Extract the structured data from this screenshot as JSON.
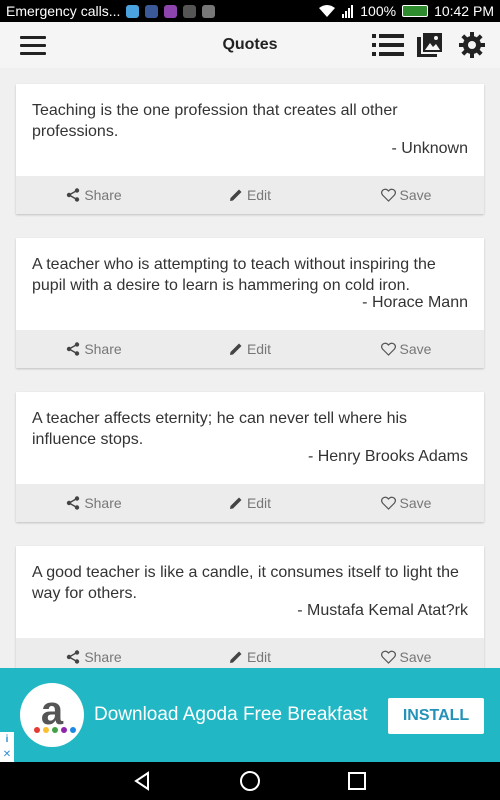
{
  "status": {
    "carrier": "Emergency calls...",
    "battery": "100%",
    "time": "10:42 PM"
  },
  "appbar": {
    "title": "Quotes"
  },
  "cards": [
    {
      "quote": "Teaching is the one profession that creates all other professions.",
      "author": "- Unknown"
    },
    {
      "quote": "A teacher who is attempting to teach without inspiring the pupil with a desire to learn is hammering on cold iron.",
      "author": "- Horace Mann"
    },
    {
      "quote": "A teacher affects eternity; he can never tell where his influence stops.",
      "author": "- Henry Brooks Adams"
    },
    {
      "quote": "A good teacher is like a candle, it consumes itself to light the way for others.",
      "author": "- Mustafa Kemal Atat?rk"
    }
  ],
  "card_actions": {
    "share": "Share",
    "edit": "Edit",
    "save": "Save"
  },
  "ad": {
    "logo_letter": "a",
    "text": "Download Agoda Free Breakfast",
    "install": "INSTALL"
  },
  "colors": {
    "ad_bg": "#22b7c4",
    "install_text": "#2392b8"
  }
}
